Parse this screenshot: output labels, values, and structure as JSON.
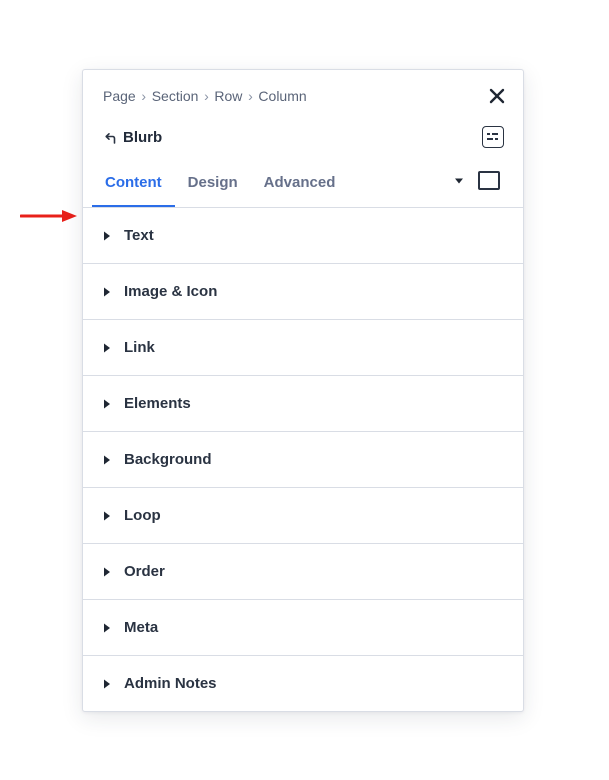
{
  "annotation": {
    "arrow_color": "#e8201a"
  },
  "breadcrumb": {
    "items": [
      "Page",
      "Section",
      "Row",
      "Column"
    ],
    "separator": "›"
  },
  "header": {
    "title": "Blurb",
    "icons": {
      "close": "close-icon",
      "back": "back-arrow-icon",
      "preset": "preset-settings-icon"
    }
  },
  "tabs": {
    "items": [
      {
        "label": "Content",
        "active": true
      },
      {
        "label": "Design",
        "active": false
      },
      {
        "label": "Advanced",
        "active": false
      }
    ],
    "tools": {
      "caret": "caret-down-icon",
      "view": "view-mode-icon"
    }
  },
  "groups": [
    {
      "label": "Text"
    },
    {
      "label": "Image & Icon"
    },
    {
      "label": "Link"
    },
    {
      "label": "Elements"
    },
    {
      "label": "Background"
    },
    {
      "label": "Loop"
    },
    {
      "label": "Order"
    },
    {
      "label": "Meta"
    },
    {
      "label": "Admin Notes"
    }
  ],
  "colors": {
    "accent": "#2b6de8",
    "text": "#2a3342",
    "muted": "#66708a",
    "border": "#d9dde5"
  }
}
